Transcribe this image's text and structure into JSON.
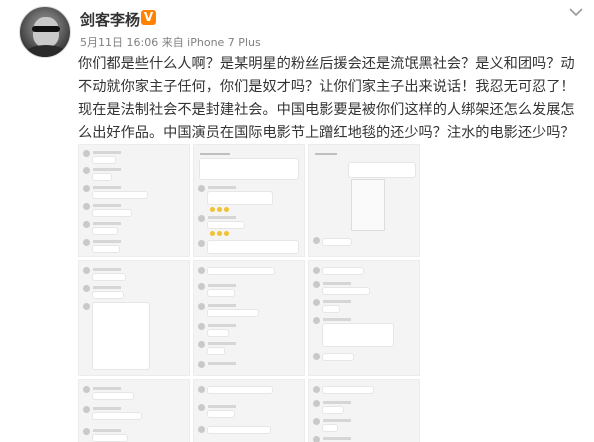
{
  "post": {
    "username": "剑客李杨",
    "verified_badge": "V",
    "meta": "5月11日 16:06 来自 iPhone 7 Plus",
    "text": "你们都是些什么人啊？是某明星的粉丝后援会还是流氓黑社会？是义和团吗？动不动就你家主子任何，你们是奴才吗？让你们家主子出来说话！我忍无可忍了！现在是法制社会不是封建社会。中国电影要是被你们这样的人绑架还怎么发展怎么出好作品。中国演员在国际电影节上蹭红地毯的还少吗？注水的电影还少吗？",
    "dropdown_icon": "chevron-down-icon",
    "accent_color": "#ff8200",
    "image_count": 9
  }
}
